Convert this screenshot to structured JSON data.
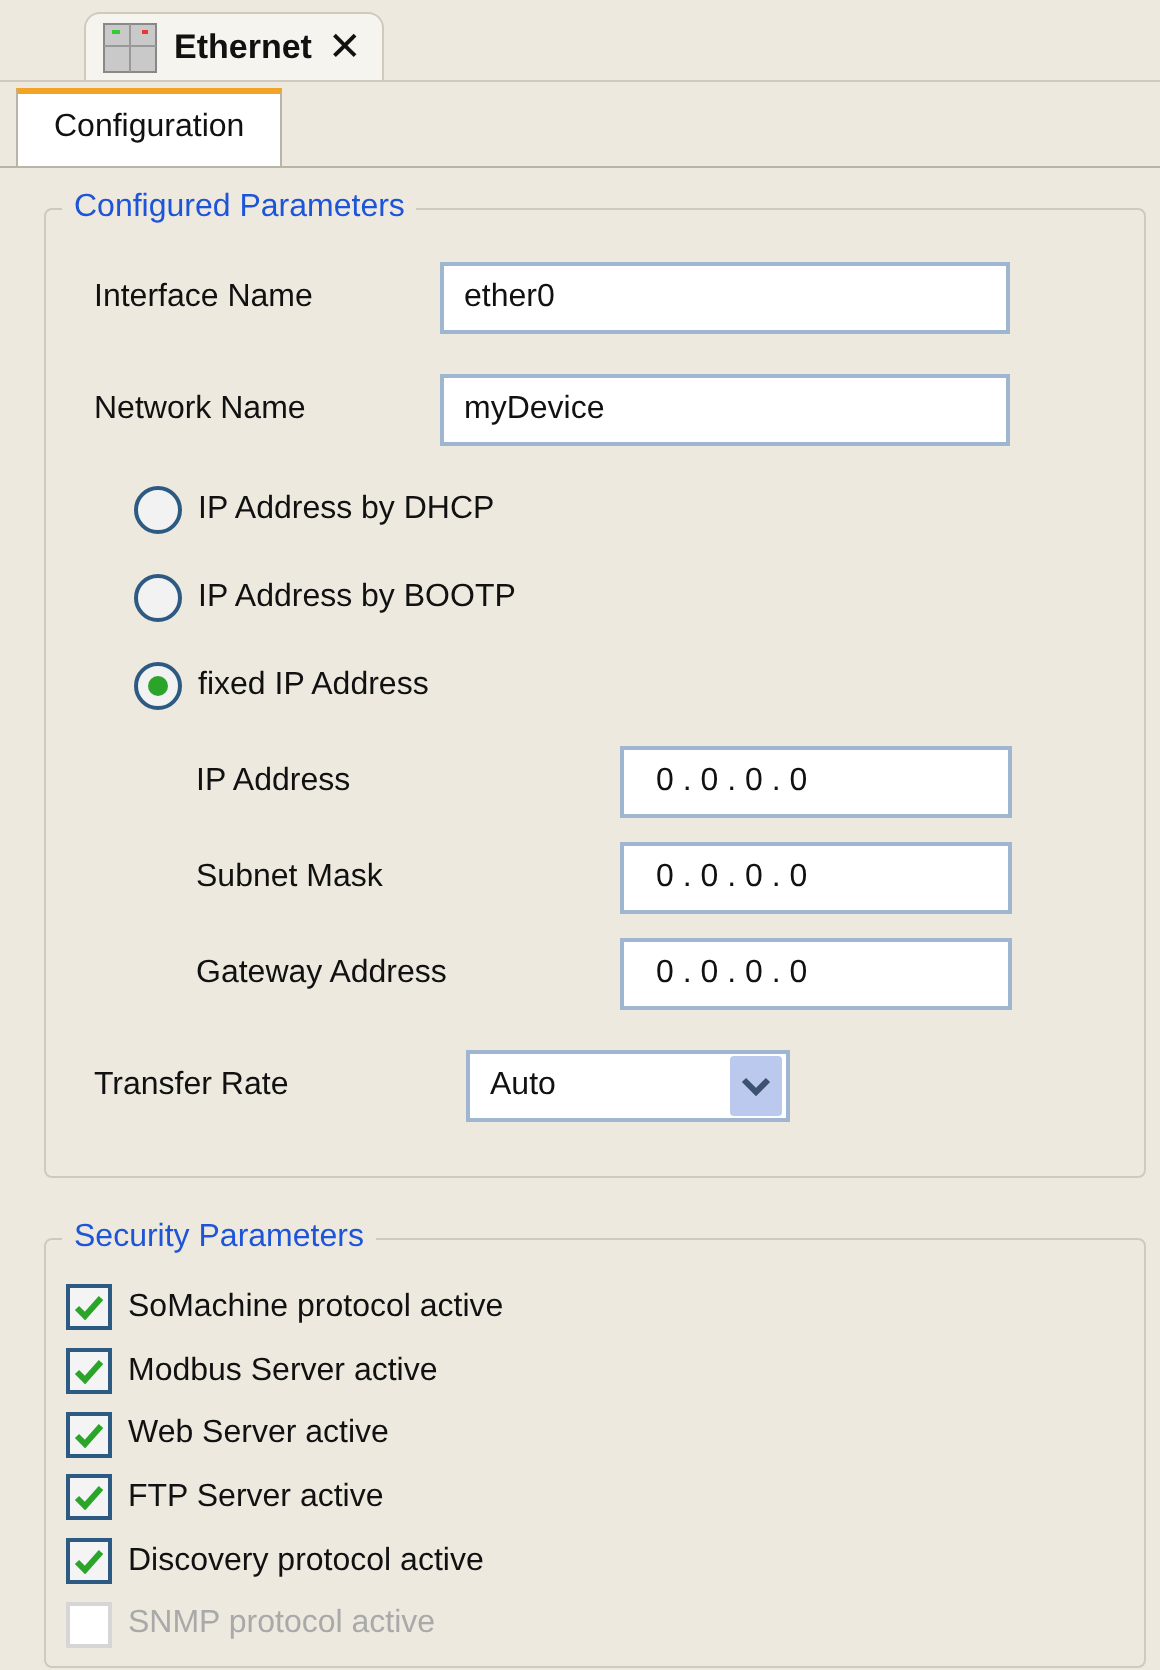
{
  "editor_tab": {
    "title": "Ethernet",
    "close": "✕"
  },
  "sub_tabs": [
    {
      "label": "Configuration",
      "selected": true
    }
  ],
  "configured": {
    "title": "Configured Parameters",
    "fields": [
      {
        "label": "Interface Name",
        "value": "ether0"
      },
      {
        "label": "Network Name",
        "value": "myDevice"
      }
    ],
    "ip_modes": [
      {
        "label": "IP Address by DHCP",
        "selected": false
      },
      {
        "label": "IP Address by BOOTP",
        "selected": false
      },
      {
        "label": "fixed IP Address",
        "selected": true
      }
    ],
    "ip_fields": [
      {
        "label": "IP Address",
        "value": "0 . 0 . 0 . 0"
      },
      {
        "label": "Subnet Mask",
        "value": "0 . 0 . 0 . 0"
      },
      {
        "label": "Gateway Address",
        "value": "0 . 0 . 0 . 0"
      }
    ],
    "transfer_rate": {
      "label": "Transfer Rate",
      "value": "Auto"
    }
  },
  "security": {
    "title": "Security Parameters",
    "options": [
      {
        "label": "SoMachine protocol active",
        "checked": true,
        "disabled": false
      },
      {
        "label": "Modbus Server active",
        "checked": true,
        "disabled": false
      },
      {
        "label": "Web Server active",
        "checked": true,
        "disabled": false
      },
      {
        "label": "FTP Server active",
        "checked": true,
        "disabled": false
      },
      {
        "label": "Discovery protocol active",
        "checked": true,
        "disabled": false
      },
      {
        "label": "SNMP protocol active",
        "checked": false,
        "disabled": true
      }
    ]
  }
}
